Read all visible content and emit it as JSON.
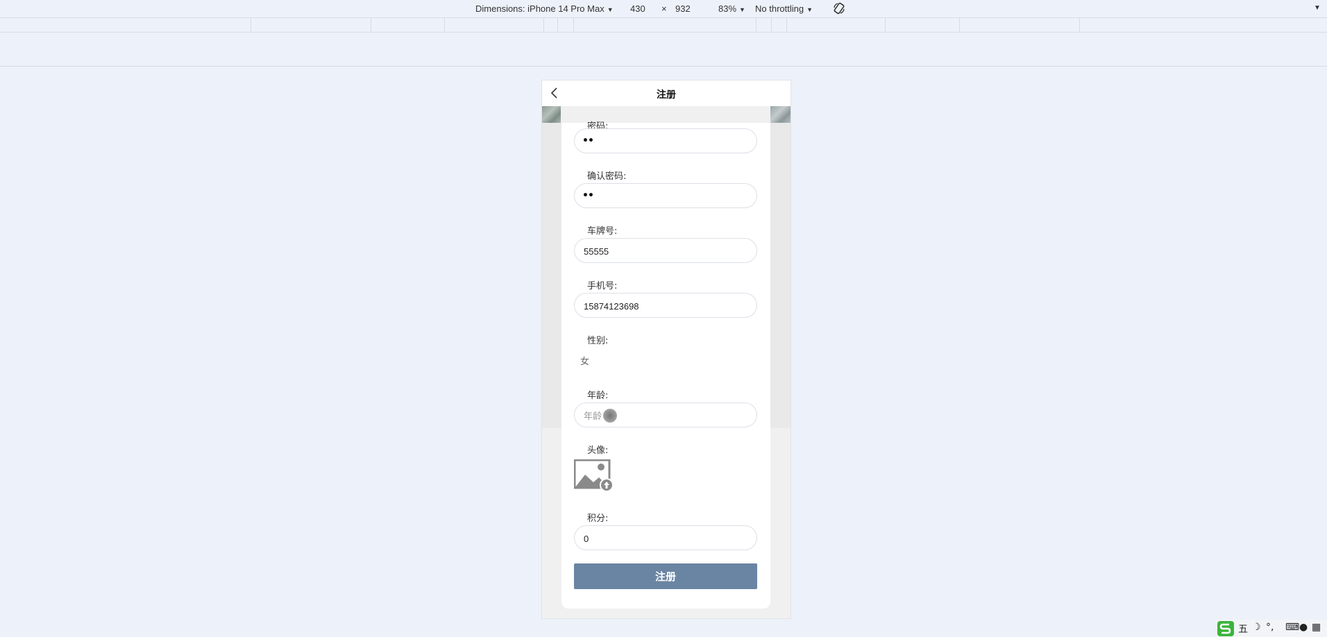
{
  "devtools": {
    "dimensions_label": "Dimensions: iPhone 14 Pro Max",
    "width": "430",
    "times": "×",
    "height": "932",
    "zoom": "83%",
    "throttling": "No throttling"
  },
  "page": {
    "title": "注册",
    "fields": {
      "password_label": "密码:",
      "password_value": "••",
      "confirm_label": "确认密码:",
      "confirm_value": "••",
      "plate_label": "车牌号:",
      "plate_value": "55555",
      "phone_label": "手机号:",
      "phone_value": "15874123698",
      "gender_label": "性别:",
      "gender_value": "女",
      "age_label": "年龄:",
      "age_placeholder": "年龄",
      "avatar_label": "头像:",
      "points_label": "积分:",
      "points_value": "0"
    },
    "submit_label": "注册"
  },
  "ime": {
    "mode": "五"
  }
}
